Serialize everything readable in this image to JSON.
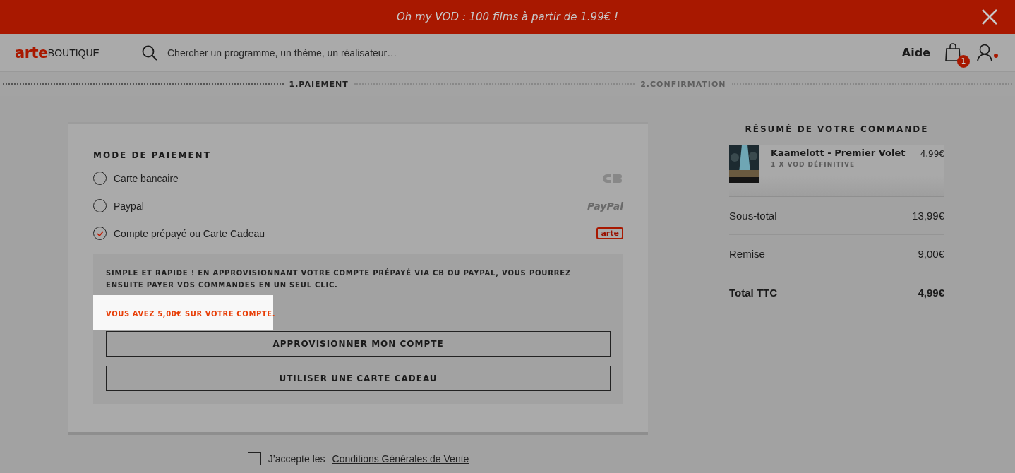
{
  "banner": {
    "text": "Oh my VOD : 100 films à partir de 1.99€ !"
  },
  "header": {
    "logo": {
      "brand": "arte",
      "shop": "BOUTIQUE"
    },
    "search": {
      "placeholder": "Chercher un programme, un thème, un réalisateur…"
    },
    "help": "Aide",
    "cart_count": "1"
  },
  "steps": [
    {
      "label": "1.PAIEMENT",
      "selected": true
    },
    {
      "label": "2.CONFIRMATION",
      "selected": false
    }
  ],
  "payment": {
    "title": "MODE DE PAIEMENT",
    "methods": [
      {
        "label": "Carte bancaire",
        "selected": false,
        "logo": {
          "kind": "cb"
        }
      },
      {
        "label": "Paypal",
        "selected": false,
        "logo": {
          "kind": "paypal",
          "text": "PayPal"
        }
      },
      {
        "label": "Compte prépayé ou Carte Cadeau",
        "selected": true,
        "logo": {
          "kind": "arte",
          "text": "arte"
        }
      }
    ],
    "info": "SIMPLE ET RAPIDE ! EN APPROVISIONNANT VOTRE COMPTE PRÉPAYÉ VIA CB OU PAYPAL, VOUS POURREZ ENSUITE PAYER VOS COMMANDES EN UN SEUL CLIC.",
    "balance": "VOUS AVEZ 5,00€ SUR VOTRE COMPTE.",
    "buttons": [
      "APPROVISIONNER MON COMPTE",
      "UTILISER UNE CARTE CADEAU"
    ]
  },
  "terms": {
    "checked": false,
    "text": "J’accepte les",
    "link": "Conditions Générales de Vente"
  },
  "summary": {
    "title": "RÉSUMÉ DE VOTRE COMMANDE",
    "item": {
      "name": "Kaamelott - Premier Volet",
      "detail": "1 X VOD DÉFINITIVE",
      "price": "4,99€"
    },
    "rows": [
      {
        "label": "Sous-total",
        "value": "13,99€",
        "bold": false
      },
      {
        "label": "Remise",
        "value": "9,00€",
        "bold": false
      },
      {
        "label": "Total TTC",
        "value": "4,99€",
        "bold": true
      }
    ]
  }
}
